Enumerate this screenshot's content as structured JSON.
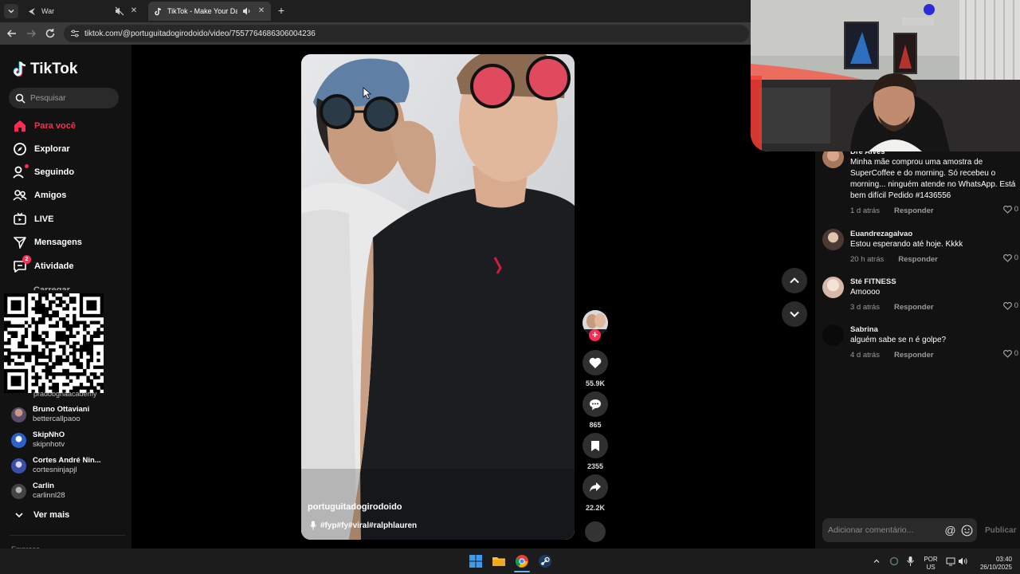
{
  "browser": {
    "tabs": [
      {
        "title": "War"
      },
      {
        "title": "TikTok - Make Your Day"
      }
    ],
    "url": "tiktok.com/@portuguitadogirodoido/video/7557764686306004236"
  },
  "tiktok": {
    "logo_text": "TikTok",
    "search_placeholder": "Pesquisar",
    "nav": [
      {
        "label": "Para você",
        "icon": "home-icon",
        "active": true
      },
      {
        "label": "Explorar",
        "icon": "compass-icon"
      },
      {
        "label": "Seguindo",
        "icon": "following-icon"
      },
      {
        "label": "Amigos",
        "icon": "friends-icon"
      },
      {
        "label": "LIVE",
        "icon": "live-icon"
      },
      {
        "label": "Mensagens",
        "icon": "messages-icon"
      },
      {
        "label": "Atividade",
        "icon": "activity-icon",
        "badge": "2"
      }
    ],
    "cut_off_item": "Carregar",
    "following_accounts": [
      {
        "name": "Bruno Ottaviani",
        "username": "bettercallpaoo"
      },
      {
        "name": "SkipNhO",
        "username": "skipnhotv"
      },
      {
        "name": "Cortes André Nin...",
        "username": "cortesninjapjl"
      },
      {
        "name": "Carlin",
        "username": "carlinnl28"
      }
    ],
    "cut_off_username": "pradobgnaacademy",
    "see_more_label": "Ver mais",
    "cut_off_bottom": "Empresa",
    "video": {
      "username": "portuguitadogirodoido",
      "hashtags": "#fyp#fy#viral#ralphlauren"
    },
    "actions": {
      "likes": "55.9K",
      "comments": "865",
      "saves": "2355",
      "shares": "22.2K"
    },
    "comments": [
      {
        "user": "Dre Alves",
        "text": "Minha mãe comprou uma amostra de SuperCoffee e do morning. Só recebeu o morning... ninguém atende no WhatsApp. Está bem difícil Pedido #1436556",
        "time": "1 d atrás",
        "reply": "Responder",
        "likes": "0"
      },
      {
        "user": "Euandrezagalvao",
        "text": "Estou esperando até hoje. Kkkk",
        "time": "20 h atrás",
        "reply": "Responder",
        "likes": "0"
      },
      {
        "user": "Sté FITNESS",
        "text": "Amoooo",
        "time": "3 d atrás",
        "reply": "Responder",
        "likes": "0"
      },
      {
        "user": "Sabrina",
        "text": "alguém sabe se n é golpe?",
        "time": "4 d atrás",
        "reply": "Responder",
        "likes": "0"
      }
    ],
    "add_comment_placeholder": "Adicionar comentário...",
    "publish_label": "Publicar"
  },
  "taskbar": {
    "lang_top": "POR",
    "lang_bottom": "US",
    "time": "03:40",
    "date": "26/10/2025"
  },
  "colors": {
    "accent": "#fe2c55",
    "background": "#000000",
    "sidebar": "#121212"
  }
}
